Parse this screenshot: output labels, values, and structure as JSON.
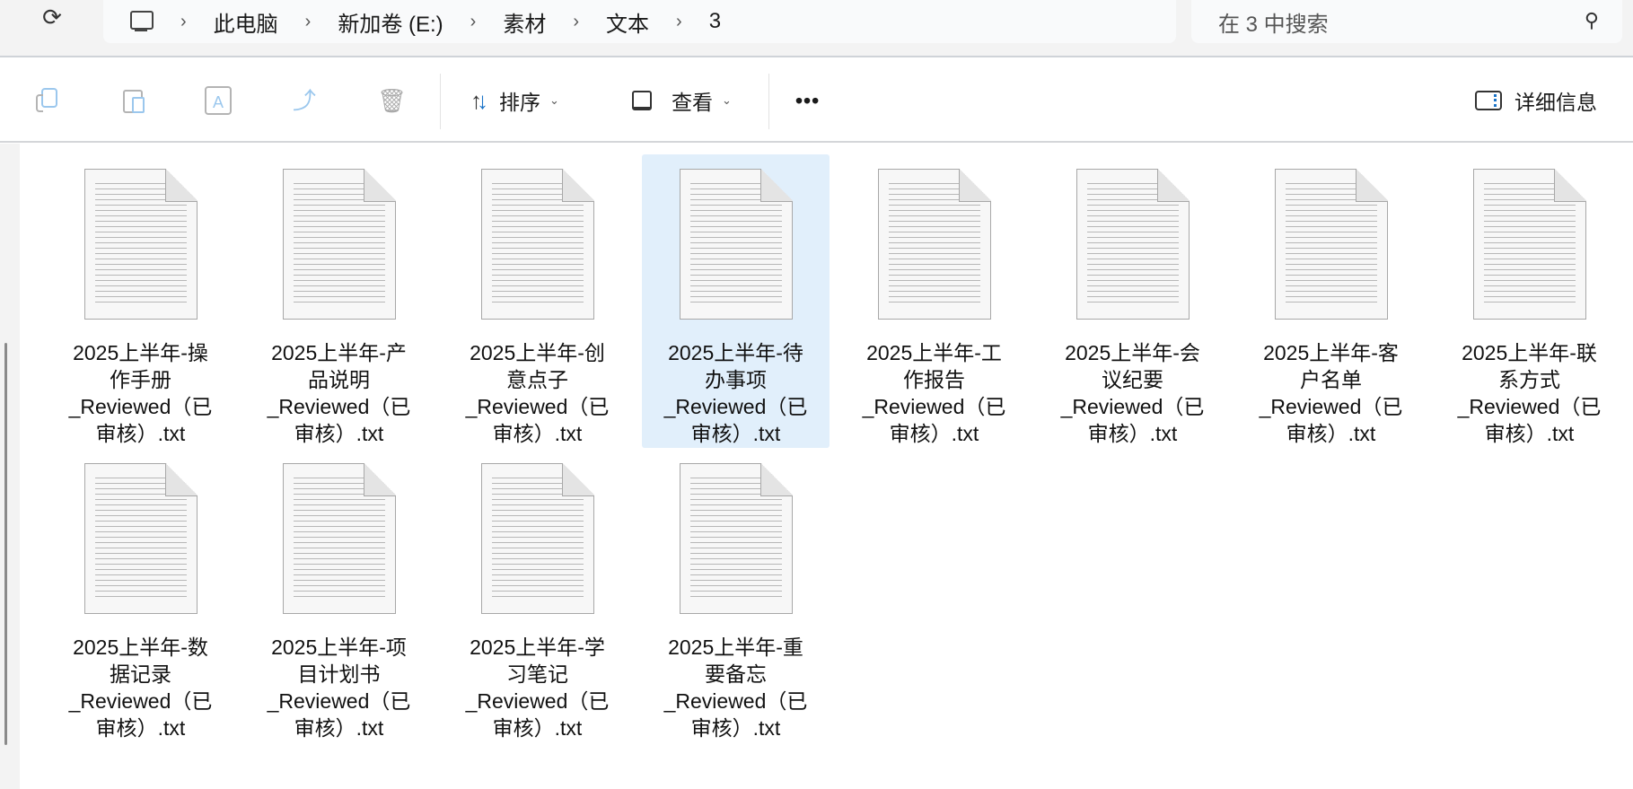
{
  "breadcrumb": [
    "此电脑",
    "新加卷 (E:)",
    "素材",
    "文本",
    "3"
  ],
  "search": {
    "placeholder": "在 3 中搜索"
  },
  "toolbar": {
    "sort": "排序",
    "view": "查看",
    "more": "•••",
    "details": "详细信息"
  },
  "files": [
    {
      "line1": "2025上半年-操",
      "line2": "作手册",
      "line3": "_Reviewed（已",
      "line4": "审核）.txt",
      "selected": false
    },
    {
      "line1": "2025上半年-产",
      "line2": "品说明",
      "line3": "_Reviewed（已",
      "line4": "审核）.txt",
      "selected": false
    },
    {
      "line1": "2025上半年-创",
      "line2": "意点子",
      "line3": "_Reviewed（已",
      "line4": "审核）.txt",
      "selected": false
    },
    {
      "line1": "2025上半年-待",
      "line2": "办事项",
      "line3": "_Reviewed（已",
      "line4": "审核）.txt",
      "selected": true
    },
    {
      "line1": "2025上半年-工",
      "line2": "作报告",
      "line3": "_Reviewed（已",
      "line4": "审核）.txt",
      "selected": false
    },
    {
      "line1": "2025上半年-会",
      "line2": "议纪要",
      "line3": "_Reviewed（已",
      "line4": "审核）.txt",
      "selected": false
    },
    {
      "line1": "2025上半年-客",
      "line2": "户名单",
      "line3": "_Reviewed（已",
      "line4": "审核）.txt",
      "selected": false
    },
    {
      "line1": "2025上半年-联",
      "line2": "系方式",
      "line3": "_Reviewed（已",
      "line4": "审核）.txt",
      "selected": false
    },
    {
      "line1": "2025上半年-数",
      "line2": "据记录",
      "line3": "_Reviewed（已",
      "line4": "审核）.txt",
      "selected": false
    },
    {
      "line1": "2025上半年-项",
      "line2": "目计划书",
      "line3": "_Reviewed（已",
      "line4": "审核）.txt",
      "selected": false
    },
    {
      "line1": "2025上半年-学",
      "line2": "习笔记",
      "line3": "_Reviewed（已",
      "line4": "审核）.txt",
      "selected": false
    },
    {
      "line1": "2025上半年-重",
      "line2": "要备忘",
      "line3": "_Reviewed（已",
      "line4": "审核）.txt",
      "selected": false
    }
  ]
}
